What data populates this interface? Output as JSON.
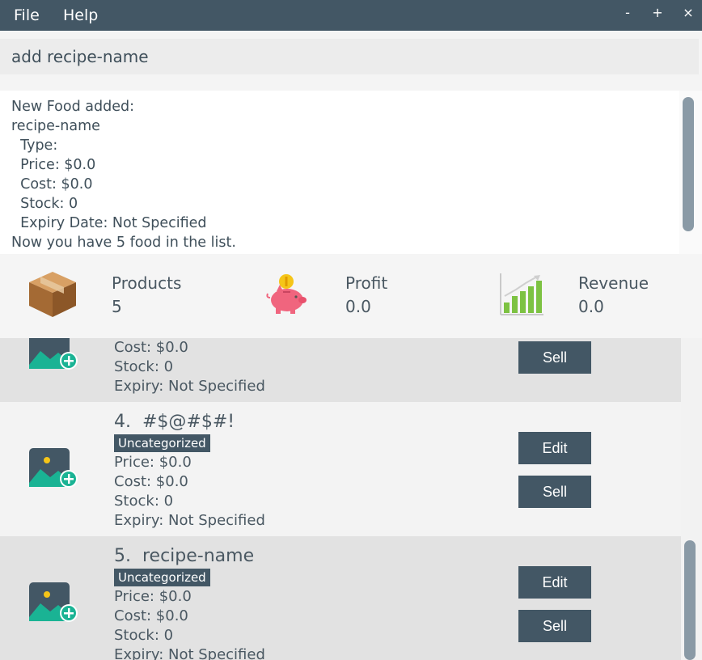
{
  "menu": {
    "file": "File",
    "help": "Help"
  },
  "window_controls": {
    "minimize": "-",
    "maximize": "+",
    "close": "×"
  },
  "command": {
    "value": "add recipe-name"
  },
  "result": {
    "lines": [
      "New Food added:",
      "recipe-name",
      "  Type:",
      "  Price: $0.0",
      "  Cost: $0.0",
      "  Stock: 0",
      "  Expiry Date: Not Specified",
      "Now you have 5 food in the list."
    ]
  },
  "stats": {
    "products": {
      "label": "Products",
      "value": "5",
      "icon": "box-icon"
    },
    "profit": {
      "label": "Profit",
      "value": "0.0",
      "icon": "piggy-bank-icon"
    },
    "revenue": {
      "label": "Revenue",
      "value": "0.0",
      "icon": "bar-chart-icon"
    }
  },
  "items": [
    {
      "cost": "Cost: $0.0",
      "stock": "Stock: 0",
      "expiry": "Expiry: Not Specified",
      "sell": "Sell"
    },
    {
      "title": "4.  #$@#$#!",
      "tag": "Uncategorized",
      "price": "Price: $0.0",
      "cost": "Cost: $0.0",
      "stock": "Stock: 0",
      "expiry": "Expiry: Not Specified",
      "edit": "Edit",
      "sell": "Sell"
    },
    {
      "title": "5.  recipe-name",
      "tag": "Uncategorized",
      "price": "Price: $0.0",
      "cost": "Cost: $0.0",
      "stock": "Stock: 0",
      "expiry": "Expiry: Not Specified",
      "edit": "Edit",
      "sell": "Sell"
    }
  ],
  "colors": {
    "primary": "#435765",
    "accent_green": "#1ab394"
  }
}
